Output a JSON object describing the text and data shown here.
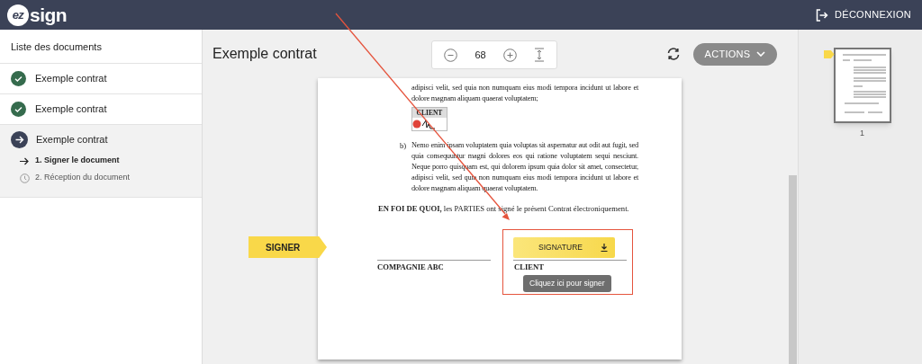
{
  "header": {
    "logo_prefix": "ez",
    "logo_suffix": "sign",
    "logout": "DÉCONNEXION"
  },
  "sidebar": {
    "title": "Liste des documents",
    "documents": [
      {
        "name": "Exemple contrat",
        "completed": true,
        "selected": false
      },
      {
        "name": "Exemple contrat",
        "completed": true,
        "selected": false
      },
      {
        "name": "Exemple contrat",
        "completed": false,
        "selected": true,
        "steps": [
          {
            "label": "1. Signer le document",
            "active": true
          },
          {
            "label": "2. Réception du document",
            "active": false
          }
        ]
      }
    ]
  },
  "viewer": {
    "title": "Exemple contrat",
    "zoom": "68",
    "actions": "ACTIONS"
  },
  "document": {
    "paragraph_top": "adipisci velit, sed quia non numquam eius modi tempora incidunt ut labore et dolore magnam aliquam quaerat voluptatem;",
    "stamp_label": "CLIENT",
    "item_marker": "b)",
    "item_text": "Nemo enim ipsam voluptatem quia voluptas sit aspernatur aut odit aut fugit, sed quia consequuntur magni dolores eos qui ratione voluptatem sequi nesciunt. Neque porro quisquam est, qui dolorem ipsum quia dolor sit amet, consectetur, adipisci velit, sed quia non numquam eius modi tempora incidunt ut labore et dolore magnam aliquam quaerat voluptatem.",
    "closing": "**EN FOI DE QUOI,** les PARTIES ont signé le présent Contrat électroniquement.",
    "party_left": "COMPAGNIE ABC",
    "party_right": "CLIENT"
  },
  "signer_tag": "SIGNER",
  "signature_field": {
    "button": "SIGNATURE",
    "tooltip": "Cliquez ici pour signer"
  },
  "thumbnails": [
    {
      "page": "1",
      "selected": true
    }
  ]
}
